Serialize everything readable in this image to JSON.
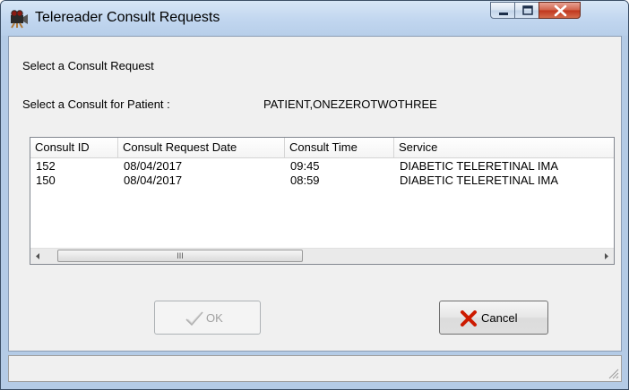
{
  "window": {
    "title": "Telereader Consult Requests",
    "icon": "telereader-camera-icon"
  },
  "controls": {
    "minimize_icon": "minimize-icon",
    "maximize_icon": "maximize-icon",
    "close_icon": "close-icon"
  },
  "form": {
    "select_label": "Select a Consult Request",
    "patient_prompt": "Select a Consult for Patient :",
    "patient_name": "PATIENT,ONEZEROTWOTHREE"
  },
  "consults": {
    "columns": [
      "Consult ID",
      "Consult Request Date",
      "Consult Time",
      "Service"
    ],
    "rows": [
      [
        "152",
        "08/04/2017",
        "09:45",
        "DIABETIC TELERETINAL IMA"
      ],
      [
        "150",
        "08/04/2017",
        "08:59",
        "DIABETIC TELERETINAL IMA"
      ]
    ],
    "scroll_thumb_glyph": "III"
  },
  "buttons": {
    "ok_label": "OK",
    "ok_icon": "checkmark-icon",
    "ok_enabled": false,
    "cancel_label": "Cancel",
    "cancel_icon": "red-x-icon"
  },
  "colors": {
    "cancel_x": "#cc1a00",
    "disabled_text": "#a0a0a0"
  }
}
